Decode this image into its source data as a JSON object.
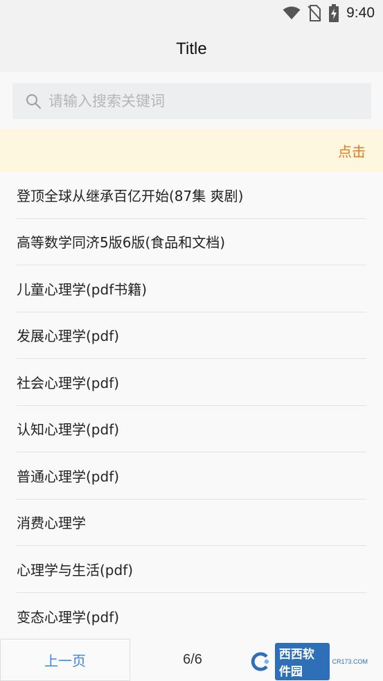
{
  "status_bar": {
    "time": "9:40",
    "icons": [
      "wifi-icon",
      "no-sim-icon",
      "battery-charging-icon"
    ]
  },
  "app_bar": {
    "title": "Title"
  },
  "search": {
    "placeholder": "请输入搜索关键词",
    "value": "",
    "icon": "search-icon"
  },
  "notice": {
    "action_label": "点击"
  },
  "list": {
    "items": [
      "登顶全球从继承百亿开始(87集 爽剧)",
      "高等数学同济5版6版(食品和文档)",
      "儿童心理学(pdf书籍)",
      "发展心理学(pdf)",
      "社会心理学(pdf)",
      "认知心理学(pdf)",
      "普通心理学(pdf)",
      "消费心理学",
      "心理学与生活(pdf)",
      "变态心理学(pdf)"
    ]
  },
  "pager": {
    "prev_label": "上一页",
    "page": "6/6"
  },
  "watermark": {
    "brand": "西西软件园",
    "site": "CR173.COM"
  },
  "colors": {
    "accent_orange": "#e9781e",
    "link_blue": "#3b86d8",
    "notice_bg": "#fdf7df"
  }
}
